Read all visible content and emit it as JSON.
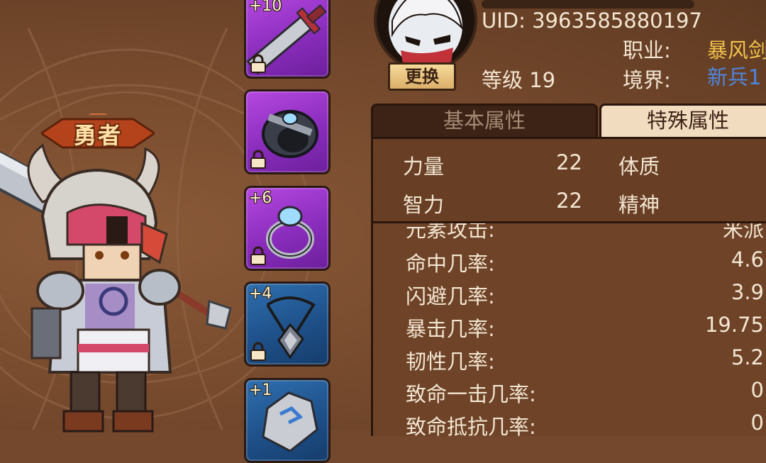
{
  "hero": {
    "title": "勇者"
  },
  "equipment": [
    {
      "enhance": "+10",
      "item": "sword-icon",
      "rarity": "purple",
      "locked": true
    },
    {
      "enhance": "",
      "item": "bracer-icon",
      "rarity": "purple",
      "locked": true
    },
    {
      "enhance": "+6",
      "item": "ring-icon",
      "rarity": "purple",
      "locked": true
    },
    {
      "enhance": "+4",
      "item": "amulet-icon",
      "rarity": "blue",
      "locked": true
    },
    {
      "enhance": "+1",
      "item": "gem-icon",
      "rarity": "blue",
      "locked": false
    }
  ],
  "profile": {
    "uid": "UID: 3963585880197",
    "level": "等级 19",
    "change_label": "更换",
    "class_label": "职业:",
    "class_value": "暴风剑",
    "realm_label": "境界:",
    "realm_value": "新兵1"
  },
  "tabs": [
    {
      "label": "基本属性",
      "active": false
    },
    {
      "label": "特殊属性",
      "active": true
    }
  ],
  "base_stats": {
    "strength": {
      "label": "力量",
      "value": "22"
    },
    "intellect": {
      "label": "智力",
      "value": "22"
    },
    "constitution": {
      "label": "体质"
    },
    "spirit": {
      "label": "精神"
    }
  },
  "special_stats": [
    {
      "label": "元素攻击:",
      "value": "米派"
    },
    {
      "label": "命中几率:",
      "value": "4.6"
    },
    {
      "label": "闪避几率:",
      "value": "3.9"
    },
    {
      "label": "暴击几率:",
      "value": "19.75"
    },
    {
      "label": "韧性几率:",
      "value": "5.2"
    },
    {
      "label": "致命一击几率:",
      "value": "0"
    },
    {
      "label": "致命抵抗几率:",
      "value": "0"
    }
  ],
  "colors": {
    "background": "#74482c",
    "accent_gold": "#f2c24a",
    "realm_blue": "#4e86e0",
    "text": "#f3e6d2"
  }
}
